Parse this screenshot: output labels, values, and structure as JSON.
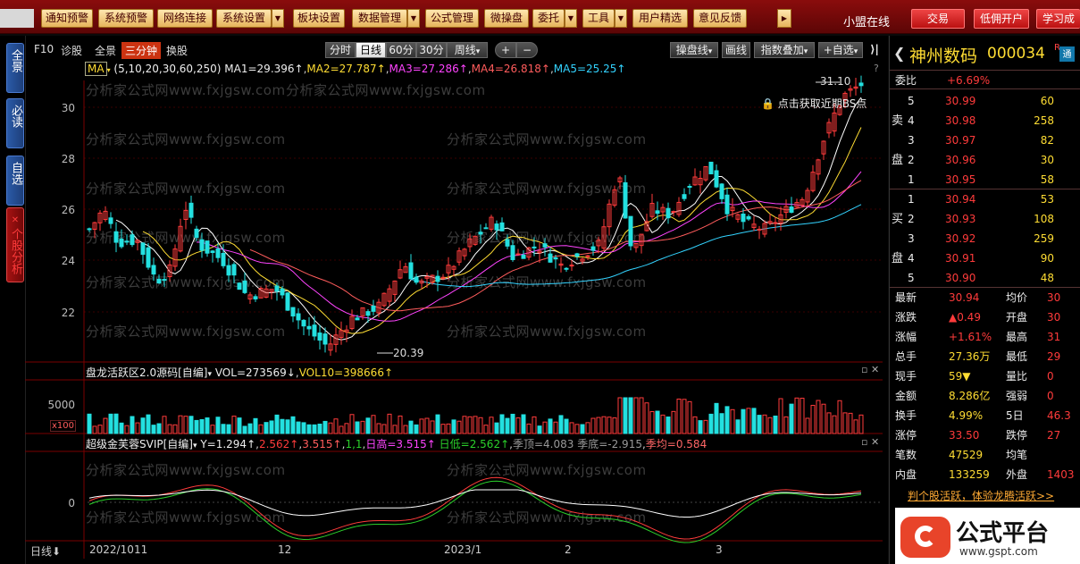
{
  "toolbar": {
    "buttons": [
      "通知预警",
      "系统预警",
      "网络连接",
      "系统设置",
      "板块设置",
      "数据管理",
      "公式管理",
      "微操盘",
      "委托",
      "工具",
      "用户精选",
      "意见反馈"
    ],
    "status": "小盟在线",
    "trade": "交易",
    "low_commission": "低佣开户",
    "learn": "学习成"
  },
  "sidetabs": [
    "全景",
    "必读",
    "自选",
    "个股分析"
  ],
  "tabs": {
    "f10": "F10",
    "diag": "诊股",
    "panorama": "全景",
    "three_min": "三分钟",
    "switch": "换股"
  },
  "periods": [
    "分时",
    "日线",
    "60分",
    "30分",
    "周线"
  ],
  "period_dropdown": "▾",
  "right_tools": {
    "drawline": "操盘线",
    "huaxian": "画线",
    "index_overlay": "指数叠加",
    "add_fav": "+自选"
  },
  "ma_legend": {
    "tag": "MA",
    "params": "(5,10,20,30,60,250)",
    "ma1": "MA1=29.396↑",
    "ma2": "MA2=27.787↑",
    "ma3": "MA3=27.286↑",
    "ma4": "MA4=26.818↑",
    "ma5": "MA5=25.25↑"
  },
  "bs_hint": "点击获取近期BS点",
  "price_labels": {
    "high": "31.10",
    "low": "20.39"
  },
  "y_axis": [
    "30",
    "28",
    "26",
    "24",
    "22"
  ],
  "vol_panel": {
    "title": "盘龙活跃区2.0源码[自编]",
    "vol": "VOL=273569↓",
    "vol10": "VOL10=398666↑",
    "y": "5000",
    "unit": "x100"
  },
  "ind_panel": {
    "title": "超级金芙蓉SVIP[自编]",
    "y": "Y=1.294↑",
    "v1": "2.562↑",
    "v2": "3.515↑",
    "v3": "1,1",
    "high": "日高=3.515↑",
    "low": "日低=2.562↑",
    "top": "季顶=4.083",
    "bottom": "季底=-2.915",
    "avg": "季均=0.584",
    "zero": "0"
  },
  "x_axis": {
    "period": "日线",
    "d1": "2022/10",
    "d2": "11",
    "d3": "12",
    "d4": "2023/1",
    "d5": "2",
    "d6": "3"
  },
  "watermark": "分析家公式网www.fxjgsw.com",
  "stock": {
    "name": "神州数码",
    "code": "000034",
    "badge": "R",
    "weibi_label": "委比",
    "weibi": "+6.69%"
  },
  "sell": [
    {
      "n": "5",
      "p": "30.99",
      "v": "60"
    },
    {
      "n": "4",
      "p": "30.98",
      "v": "258"
    },
    {
      "n": "3",
      "p": "30.97",
      "v": "82"
    },
    {
      "n": "2",
      "p": "30.96",
      "v": "30"
    },
    {
      "n": "1",
      "p": "30.95",
      "v": "58"
    }
  ],
  "buy": [
    {
      "n": "1",
      "p": "30.94",
      "v": "53"
    },
    {
      "n": "2",
      "p": "30.93",
      "v": "108"
    },
    {
      "n": "3",
      "p": "30.92",
      "v": "259"
    },
    {
      "n": "4",
      "p": "30.91",
      "v": "90"
    },
    {
      "n": "5",
      "p": "30.90",
      "v": "48"
    }
  ],
  "side_sell": [
    "卖",
    "盘"
  ],
  "side_buy": [
    "买",
    "盘"
  ],
  "quote": [
    [
      "最新",
      "30.94",
      "均价",
      "30"
    ],
    [
      "涨跌",
      "▲0.49",
      "开盘",
      "30"
    ],
    [
      "涨幅",
      "+1.61%",
      "最高",
      "31"
    ],
    [
      "总手",
      "27.36万",
      "最低",
      "29"
    ],
    [
      "现手",
      "59▼",
      "量比",
      "0"
    ],
    [
      "金额",
      "8.286亿",
      "强弱",
      "0"
    ],
    [
      "换手",
      "4.99%",
      "5日",
      "46.3"
    ],
    [
      "涨停",
      "33.50",
      "跌停",
      "27"
    ],
    [
      "笔数",
      "47529",
      "均笔",
      ""
    ],
    [
      "内盘",
      "133259",
      "外盘",
      "1403"
    ]
  ],
  "promo": "判个股活跃，体验龙腾活跃>>",
  "brand": {
    "name": "公式平台",
    "url": "www.gspt.com"
  },
  "colors": {
    "up": "#ff3b3b",
    "down": "#23e0e0",
    "ma1": "#ffffff",
    "ma2": "#ffdd33",
    "ma3": "#ff44ff",
    "ma4": "#ff5c5c",
    "ma5": "#33d3ff"
  }
}
